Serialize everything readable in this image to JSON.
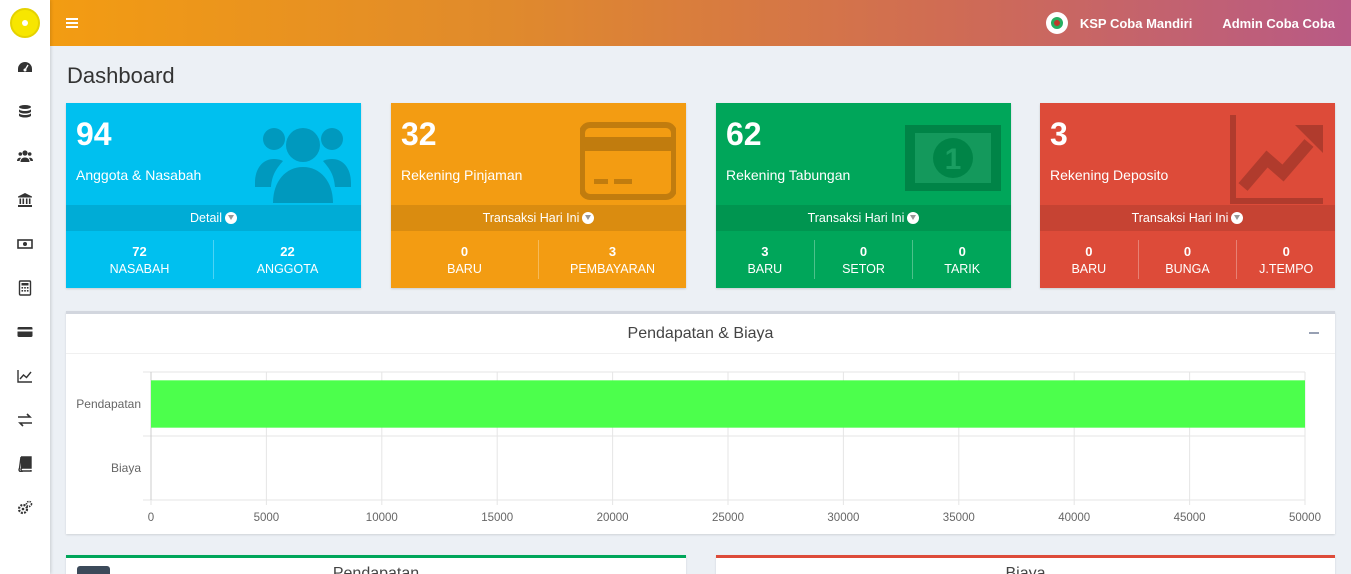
{
  "header": {
    "org_name": "KSP Coba Mandiri",
    "user_name": "Admin Coba Coba"
  },
  "sidebar": {
    "items": [
      {
        "icon": "dashboard-icon"
      },
      {
        "icon": "database-icon"
      },
      {
        "icon": "users-icon"
      },
      {
        "icon": "bank-icon"
      },
      {
        "icon": "money-icon"
      },
      {
        "icon": "calculator-icon"
      },
      {
        "icon": "credit-card-icon"
      },
      {
        "icon": "line-chart-icon"
      },
      {
        "icon": "exchange-icon"
      },
      {
        "icon": "book-icon"
      },
      {
        "icon": "settings-icon"
      }
    ]
  },
  "page": {
    "title": "Dashboard"
  },
  "boxes": [
    {
      "value": "94",
      "label": "Anggota & Nasabah",
      "link": "Detail",
      "color": "#00c0ef",
      "stats": [
        {
          "value": "72",
          "label": "NASABAH"
        },
        {
          "value": "22",
          "label": "ANGGOTA"
        }
      ]
    },
    {
      "value": "32",
      "label": "Rekening Pinjaman",
      "link": "Transaksi Hari Ini",
      "color": "#f39c12",
      "stats": [
        {
          "value": "0",
          "label": "BARU"
        },
        {
          "value": "3",
          "label": "PEMBAYARAN"
        }
      ]
    },
    {
      "value": "62",
      "label": "Rekening Tabungan",
      "link": "Transaksi Hari Ini",
      "color": "#00a65a",
      "stats": [
        {
          "value": "3",
          "label": "BARU"
        },
        {
          "value": "0",
          "label": "SETOR"
        },
        {
          "value": "0",
          "label": "TARIK"
        }
      ]
    },
    {
      "value": "3",
      "label": "Rekening Deposito",
      "link": "Transaksi Hari Ini",
      "color": "#dd4b39",
      "stats": [
        {
          "value": "0",
          "label": "BARU"
        },
        {
          "value": "0",
          "label": "BUNGA"
        },
        {
          "value": "0",
          "label": "J.TEMPO"
        }
      ]
    }
  ],
  "chart_panel": {
    "title": "Pendapatan & Biaya"
  },
  "chart_data": {
    "type": "bar",
    "orientation": "horizontal",
    "title": "Pendapatan & Biaya",
    "categories": [
      "Pendapatan",
      "Biaya"
    ],
    "values": [
      50000,
      0
    ],
    "bar_color": "#4cff4c",
    "xlim": [
      0,
      50000
    ],
    "xticks": [
      "0",
      "5000",
      "10000",
      "15000",
      "20000",
      "25000",
      "30000",
      "35000",
      "40000",
      "45000",
      "50000"
    ],
    "grid": true
  },
  "bottom_panels": [
    {
      "title": "Pendapatan",
      "color": "#00a65a"
    },
    {
      "title": "Biaya",
      "color": "#dd4b39"
    }
  ]
}
